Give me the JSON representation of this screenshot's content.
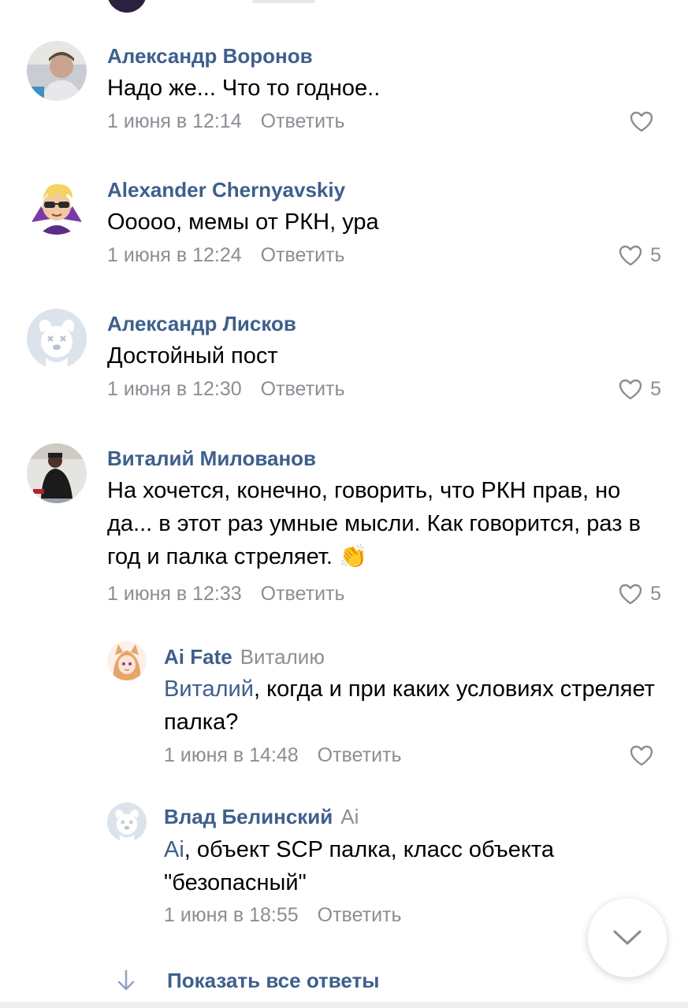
{
  "comments": [
    {
      "author": "Александр Воронов",
      "reply_to": "",
      "mention": "",
      "text": "Надо же... Что то годное..",
      "time": "1 июня в 12:14",
      "reply_label": "Ответить",
      "likes": ""
    },
    {
      "author": "Alexander Chernyavskiy",
      "reply_to": "",
      "mention": "",
      "text": "Ооооо, мемы от РКН, ура",
      "time": "1 июня в 12:24",
      "reply_label": "Ответить",
      "likes": "5"
    },
    {
      "author": "Александр Лисков",
      "reply_to": "",
      "mention": "",
      "text": "Достойный пост",
      "time": "1 июня в 12:30",
      "reply_label": "Ответить",
      "likes": "5"
    },
    {
      "author": "Виталий Милованов",
      "reply_to": "",
      "mention": "",
      "text": "На хочется, конечно, говорить, что РКН прав, но да... в этот раз умные мысли. Как говорится, раз в год и палка стреляет. 👏",
      "time": "1 июня в 12:33",
      "reply_label": "Ответить",
      "likes": "5"
    },
    {
      "author": "Ai Fate",
      "reply_to": "Виталию",
      "mention": "Виталий",
      "text": ", когда и при каких условиях стреляет палка?",
      "time": "1 июня в 14:48",
      "reply_label": "Ответить",
      "likes": ""
    },
    {
      "author": "Влад Белинский",
      "reply_to": "Ai",
      "mention": "Ai",
      "text": ", объект SCP палка, класс объекта \"безопасный\"",
      "time": "1 июня в 18:55",
      "reply_label": "Ответить",
      "likes": ""
    }
  ],
  "show_all_replies": "Показать все ответы",
  "colors": {
    "link": "#3e5f8c",
    "meta": "#8a8e94",
    "deleted_avatar_bg": "#dde3ea"
  }
}
